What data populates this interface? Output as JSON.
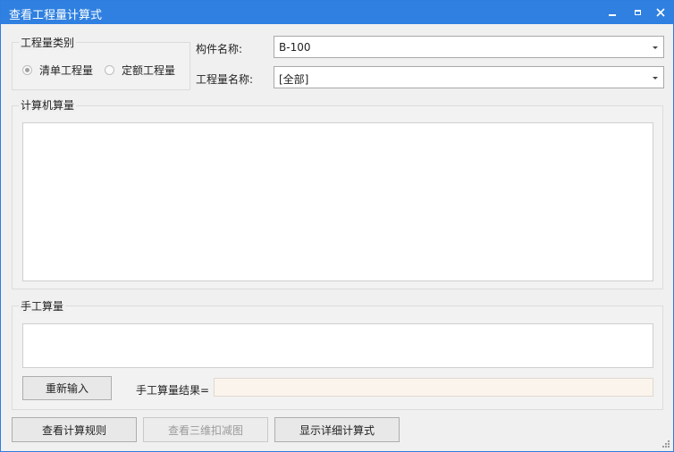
{
  "window": {
    "title": "查看工程量计算式"
  },
  "quantity_type": {
    "title": "工程量类别",
    "options": [
      {
        "label": "清单工程量",
        "checked": true
      },
      {
        "label": "定额工程量",
        "checked": false
      }
    ]
  },
  "component": {
    "label": "构件名称:",
    "value": "B-100"
  },
  "quantity_name": {
    "label": "工程量名称:",
    "value": "[全部]"
  },
  "computer_calc": {
    "title": "计算机算量",
    "content": ""
  },
  "manual_calc": {
    "title": "手工算量",
    "content": "",
    "reinput_label": "重新输入",
    "result_label": "手工算量结果=",
    "result_value": ""
  },
  "buttons": {
    "view_rules": "查看计算规则",
    "view_3d": "查看三维扣减图",
    "show_detail": "显示详细计算式"
  }
}
